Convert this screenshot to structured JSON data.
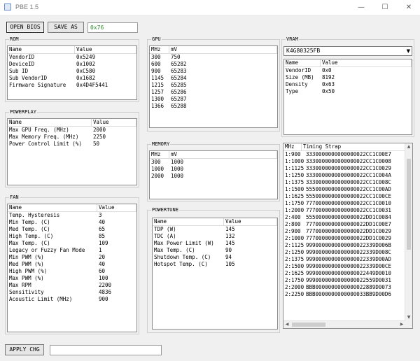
{
  "window": {
    "title": "PBE 1.5",
    "minimize": "—",
    "maximize": "☐",
    "close": "✕"
  },
  "toolbar": {
    "open_bios": "OPEN BIOS",
    "save_as": "SAVE AS",
    "checksum": "0x76"
  },
  "rom": {
    "title": "ROM",
    "columns": [
      "Name",
      "Value"
    ],
    "rows": [
      [
        "VendorID",
        "0x5249"
      ],
      [
        "DeviceID",
        "0x1002"
      ],
      [
        "Sub ID",
        "0xC580"
      ],
      [
        "Sub VendorID",
        "0x1682"
      ],
      [
        "Firmware Signature",
        "0x4D4F5441"
      ]
    ]
  },
  "powerplay": {
    "title": "POWERPLAY",
    "columns": [
      "Name",
      "Value"
    ],
    "rows": [
      [
        "Max GPU Freq. (MHz)",
        "2000"
      ],
      [
        "Max Memory Freq. (MHz)",
        "2250"
      ],
      [
        "Power Control Limit (%)",
        "50"
      ]
    ]
  },
  "fan": {
    "title": "FAN",
    "columns": [
      "Name",
      "Value"
    ],
    "rows": [
      [
        "Temp. Hysteresis",
        "3"
      ],
      [
        "Min Temp. (C)",
        "40"
      ],
      [
        "Med Temp. (C)",
        "65"
      ],
      [
        "High Temp. (C)",
        "85"
      ],
      [
        "Max Temp. (C)",
        "109"
      ],
      [
        "Legacy or Fuzzy Fan Mode",
        "1"
      ],
      [
        "Min PWM (%)",
        "20"
      ],
      [
        "Med PWM (%)",
        "40"
      ],
      [
        "High PWM (%)",
        "60"
      ],
      [
        "Max PWM (%)",
        "100"
      ],
      [
        "Max RPM",
        "2200"
      ],
      [
        "Sensitivity",
        "4836"
      ],
      [
        "Acoustic Limit (MHz)",
        "900"
      ]
    ]
  },
  "gpu": {
    "title": "GPU",
    "columns": [
      "MHz",
      "mV"
    ],
    "rows": [
      [
        "300",
        "750"
      ],
      [
        "600",
        "65282"
      ],
      [
        "900",
        "65283"
      ],
      [
        "1145",
        "65284"
      ],
      [
        "1215",
        "65285"
      ],
      [
        "1257",
        "65286"
      ],
      [
        "1300",
        "65287"
      ],
      [
        "1366",
        "65288"
      ]
    ]
  },
  "memory": {
    "title": "MEMORY",
    "columns": [
      "MHz",
      "mV"
    ],
    "rows": [
      [
        "300",
        "1000"
      ],
      [
        "1000",
        "1000"
      ],
      [
        "2000",
        "1000"
      ]
    ]
  },
  "powertune": {
    "title": "POWERTUNE",
    "columns": [
      "Name",
      "Value"
    ],
    "rows": [
      [
        "TDP (W)",
        "145"
      ],
      [
        "TDC (A)",
        "132"
      ],
      [
        "Max Power Limit (W)",
        "145"
      ],
      [
        "Max Temp. (C)",
        "90"
      ],
      [
        "Shutdown Temp. (C)",
        "94"
      ],
      [
        "Hotspot Temp. (C)",
        "105"
      ]
    ]
  },
  "vram": {
    "title": "VRAM",
    "selected": "K4G80325FB",
    "columns": [
      "Name",
      "Value"
    ],
    "rows": [
      [
        "VendorID",
        "0x0"
      ],
      [
        "Size (MB)",
        "8192"
      ],
      [
        "Density",
        "0x63"
      ],
      [
        "Type",
        "0x50"
      ]
    ]
  },
  "timing": {
    "columns": [
      "MHz",
      "Timing Strap"
    ],
    "rows": [
      [
        "1:900",
        "3330000000000000022CC1C00E7"
      ],
      [
        "1:1000",
        "3330000000000000022CC1C0008"
      ],
      [
        "1:1125",
        "3330000000000000022CC1C0029"
      ],
      [
        "1:1250",
        "3330000000000000022CC1C004A"
      ],
      [
        "1:1375",
        "3330000000000000022CC1C008C"
      ],
      [
        "1:1500",
        "5550000000000000022CC1C00AD"
      ],
      [
        "1:1625",
        "5550000000000000022CC1C00CE"
      ],
      [
        "1:1750",
        "7770000000000000022CC1C0010"
      ],
      [
        "1:2000",
        "7770000000000000022CC1C0031"
      ],
      [
        "2:400",
        "5550000000000000022DD1C0084"
      ],
      [
        "2:800",
        "7770000000000000022DD1C00E7"
      ],
      [
        "2:900",
        "7770000000000000022DD1C0029"
      ],
      [
        "2:1000",
        "7770000000000000022DD1C0029"
      ],
      [
        "2:1125",
        "9990000000000000022339D006B"
      ],
      [
        "2:1250",
        "9990000000000000022339D008C"
      ],
      [
        "2:1375",
        "9990000000000000022339D00AD"
      ],
      [
        "2:1500",
        "9990000000000000022339D00CE"
      ],
      [
        "2:1625",
        "9990000000000000022449D0010"
      ],
      [
        "2:1750",
        "9990000000000000022559D0031"
      ],
      [
        "2:2000",
        "BBB0000000000000022889D0073"
      ],
      [
        "2:2250",
        "BBB0000000000000033BB9D00D6"
      ]
    ]
  },
  "footer": {
    "apply": "APPLY CHG",
    "status": ""
  }
}
